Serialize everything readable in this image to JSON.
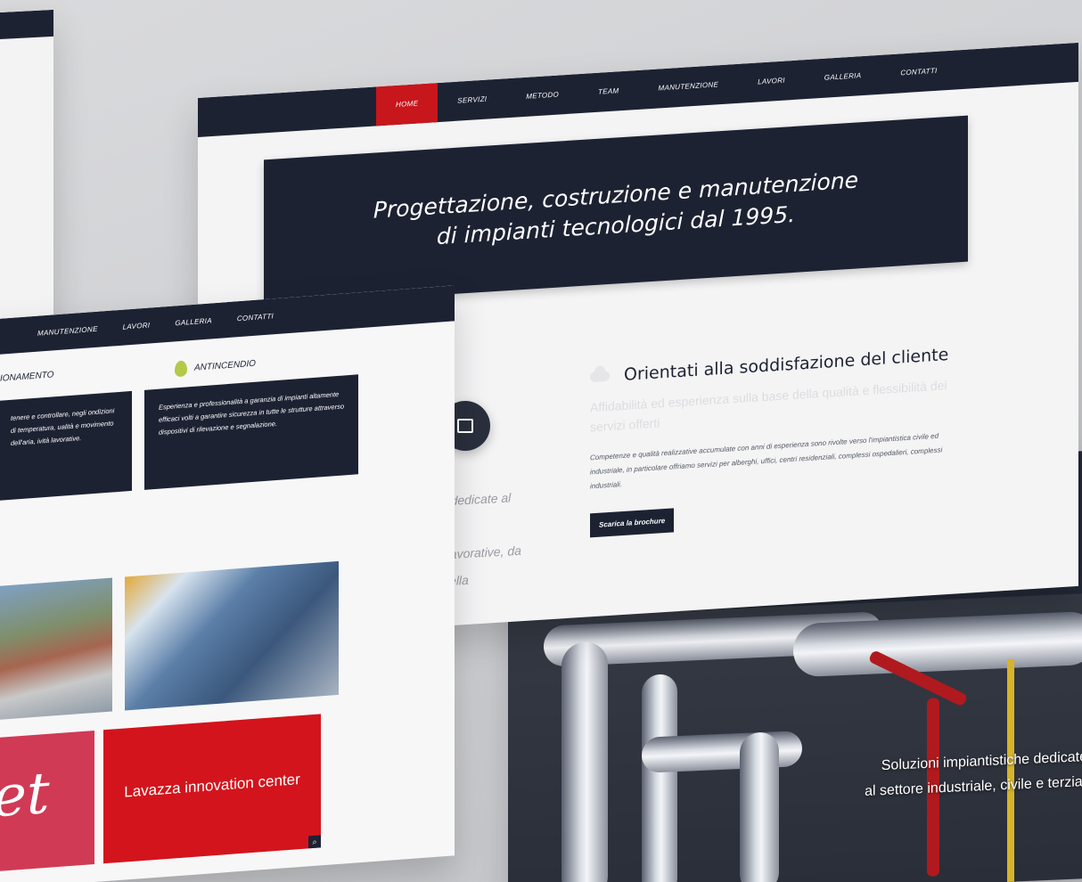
{
  "main_site": {
    "nav": [
      "HOME",
      "SERVIZI",
      "METODO",
      "TEAM",
      "MANUTENZIONE",
      "LAVORI",
      "GALLERIA",
      "CONTATTI"
    ],
    "active_nav": "HOME",
    "hero_line1": "Progettazione, costruzione e manutenzione",
    "hero_line2": "di impianti tecnologici dal 1995.",
    "feature_title": "Orientati alla soddisfazione del cliente",
    "feature_faded": "Affidabilità ed esperienza sulla base della qualità e flessibilità dei servizi offerti",
    "feature_body": "Competenze e qualità realizzative accumulate con anni di esperienza sono rivolte verso l'impiantistica civile ed industriale, in particolare offriamo servizi per alberghi, uffici, centri residenziali, complessi ospedalieri, complessi industriali.",
    "brochure_button": "Scarica la brochure"
  },
  "partial_text": {
    "line1": "istiche dedicate al",
    "line2": "lo.",
    "line3": "ci fasi lavorative, da",
    "line4": "le a quella"
  },
  "photo": {
    "caption_line1": "Soluzioni impiantistiche dedicate",
    "caption_line2": "al settore industriale, civile e terziar"
  },
  "front_site": {
    "nav": [
      "MANUTENZIONE",
      "LAVORI",
      "GALLERIA",
      "CONTATTI"
    ],
    "service_left_title": "IONAMENTO",
    "service_left_text": "tenere e controllare, negli ondizioni di temperatura, ualità e movimento dell'aria, ività lavorative.",
    "service_right_title": "ANTINCENDIO",
    "service_right_text": "Esperienza e professionalità a garanzia di impianti altamente efficaci volti a garantire sicurezza in tutte le strutture attraverso dispositivi di rilevazione e segnalazione.",
    "tile_caption": "Lavazza innovation center",
    "tile_sign_text": "et"
  },
  "colors": {
    "navy": "#1d2233",
    "red": "#c7161c",
    "accent_green": "#b4c84a"
  }
}
